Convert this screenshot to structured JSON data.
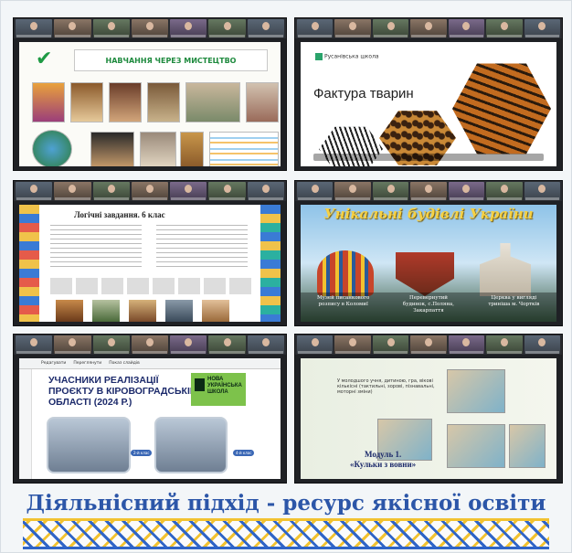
{
  "footer": {
    "title": "Діяльнісний підхід - ресурс якісної освіти"
  },
  "tiles": {
    "t1": {
      "slide_title": "НАВЧАННЯ ЧЕРЕЗ МИСТЕЦТВО",
      "check_icon": "check-icon"
    },
    "t2": {
      "logo_text": "Русанівська школа",
      "slide_title": "Фактура тварин"
    },
    "t3": {
      "slide_title": "Логічні завдання. 6 клас"
    },
    "t4": {
      "slide_title": "Унікальні будівлі України",
      "captions": [
        "Музей писанкового розпису в Коломиї",
        "Перевернутий будинок, с.Поляна, Закарпаття",
        "Церква у вигляді триніша м. Чортків"
      ]
    },
    "t5": {
      "menu": [
        "Редагувати",
        "Переглянути",
        "Показ слайдів"
      ],
      "heading": "УЧАСНИКИ РЕАЛІЗАЦІЇ ПРОЄКТУ В КІРОВОГРАДСЬКІЙ ОБЛАСТІ (2024 Р.)",
      "badge": "НОВА УКРАЇНСЬКА ШКОЛА",
      "chip1": "2-й клас",
      "chip2": "4-й клас"
    },
    "t6": {
      "paragraph": "У молодшого учня, дитиною, гра, вікові кількісні (тактильні, зорові, пізнавальні, моторні зміни)",
      "module_line1": "Модуль 1.",
      "module_line2": "«Кульки з вовни»"
    }
  },
  "colors": {
    "footer_title": "#2c56a8",
    "ornament_blue": "#2f64c7",
    "ornament_yellow": "#f2c230",
    "nus_green": "#7dc24b"
  }
}
